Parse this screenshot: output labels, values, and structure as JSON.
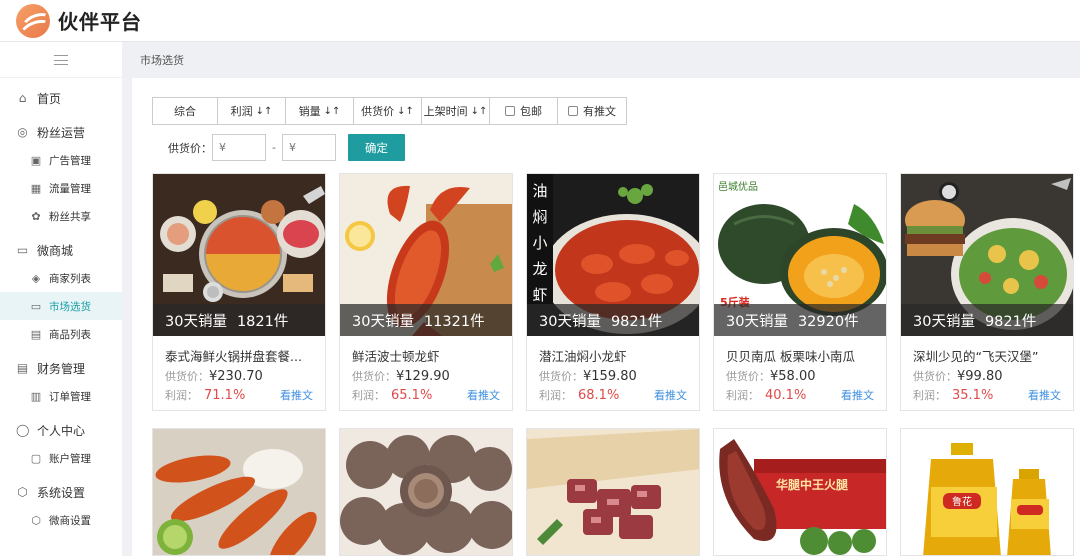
{
  "app": {
    "title": "伙伴平台"
  },
  "breadcrumb": "市场选货",
  "sidebar": {
    "groups": [
      {
        "label": "首页",
        "icon": "home-icon",
        "items": []
      },
      {
        "label": "粉丝运营",
        "icon": "fans-icon",
        "items": [
          {
            "label": "广告管理",
            "icon": "ad-icon"
          },
          {
            "label": "流量管理",
            "icon": "traffic-icon"
          },
          {
            "label": "粉丝共享",
            "icon": "share-icon"
          }
        ]
      },
      {
        "label": "微商城",
        "icon": "store-icon",
        "items": [
          {
            "label": "商家列表",
            "icon": "merchant-list-icon"
          },
          {
            "label": "市场选货",
            "icon": "market-icon",
            "active": true
          },
          {
            "label": "商品列表",
            "icon": "product-list-icon"
          }
        ]
      },
      {
        "label": "财务管理",
        "icon": "finance-icon",
        "items": [
          {
            "label": "订单管理",
            "icon": "order-icon"
          }
        ]
      },
      {
        "label": "个人中心",
        "icon": "user-icon",
        "items": [
          {
            "label": "账户管理",
            "icon": "account-icon"
          }
        ]
      },
      {
        "label": "系统设置",
        "icon": "settings-icon",
        "items": [
          {
            "label": "微商设置",
            "icon": "micro-settings-icon"
          }
        ]
      }
    ]
  },
  "sort": {
    "comprehensive": "综合",
    "profit": "利润",
    "sales": "销量",
    "supply_price": "供货价",
    "listing_time": "上架时间",
    "free_shipping": "包邮",
    "has_post": "有推文",
    "arrow": "↓↑"
  },
  "filter": {
    "label": "供货价：",
    "min_placeholder": "¥",
    "max_placeholder": "¥",
    "dash": "-",
    "confirm": "确定"
  },
  "card_labels": {
    "sales_prefix": "30天销量",
    "price_prefix": "供货价：",
    "profit_prefix": "利润：",
    "post_link": "看推文"
  },
  "products": [
    {
      "name": "泰式海鲜火锅拼盘套餐...",
      "sales": "1821件",
      "price": "¥230.70",
      "profit": "71.1%",
      "image": "hotpot-image"
    },
    {
      "name": "鲜活波士顿龙虾",
      "sales": "11321件",
      "price": "¥129.90",
      "profit": "65.1%",
      "image": "lobster-image"
    },
    {
      "name": "潜江油焖小龙虾",
      "sales": "9821件",
      "price": "¥159.80",
      "profit": "68.1%",
      "image": "crayfish-image",
      "badge": "油焖小龙虾"
    },
    {
      "name": "贝贝南瓜 板栗味小南瓜",
      "sales": "32920件",
      "price": "¥58.00",
      "profit": "40.1%",
      "image": "pumpkin-image",
      "badge": "邑城优品",
      "badge2": "5斤装"
    },
    {
      "name": "深圳少见的“飞天汉堡”",
      "sales": "9821件",
      "price": "¥99.80",
      "profit": "35.1%",
      "image": "burger-image"
    }
  ],
  "products_row2": [
    {
      "image": "shrimp-image"
    },
    {
      "image": "meatball-image"
    },
    {
      "image": "beef-image"
    },
    {
      "image": "ham-image",
      "box_text": "华腿中王火腿"
    },
    {
      "image": "oil-image",
      "label_text": "鲁花"
    }
  ]
}
